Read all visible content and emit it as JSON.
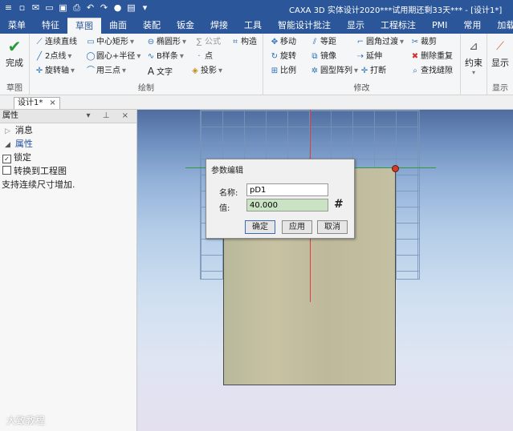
{
  "window": {
    "title": "CAXA 3D 实体设计2020***试用期还剩33天*** - [设计1*]",
    "quick_access_icons": [
      "app-menu-icon",
      "new-file-icon",
      "email-icon",
      "open-folder-icon",
      "save-icon",
      "print-icon",
      "undo-icon",
      "redo-icon",
      "globe-icon",
      "image-icon",
      "dropdown-icon"
    ]
  },
  "menu": {
    "tabs": [
      "菜单",
      "特征",
      "草图",
      "曲面",
      "装配",
      "钣金",
      "焊接",
      "工具",
      "智能设计批注",
      "显示",
      "工程标注",
      "PMI",
      "常用",
      "加载"
    ],
    "active": "草图"
  },
  "ribbon": {
    "groups": {
      "sketch": "草图",
      "draw": "绘制",
      "modify": "修改",
      "display": "显示"
    },
    "finish": "完成",
    "constrain": "约束",
    "display_btn": "显示",
    "draw_items": {
      "polyline": "连续直线",
      "center_rect": "中心矩形",
      "ellipse": "椭圆形",
      "formula": "公式",
      "construct": "构造",
      "two_point_line": "2点线",
      "circle_center_radius": "圆心+半径",
      "bspline": "B样条",
      "point": "点",
      "rotate_axis": "旋转轴",
      "three_point_arc": "用三点",
      "text": "文字",
      "projection": "投影"
    },
    "modify_items": {
      "move": "移动",
      "offset": "等距",
      "fillet": "圆角过渡",
      "trim": "裁剪",
      "rotate": "旋转",
      "mirror": "镜像",
      "extend": "延伸",
      "delete_dup": "删除重复",
      "scale": "比例",
      "circular_array": "圆型阵列",
      "break": "打断",
      "find_gaps": "查找缝隙"
    }
  },
  "document_tab": {
    "label": "设计1*",
    "close": "×"
  },
  "panel": {
    "title": "属性",
    "controls": "▾ ⊥ ×",
    "section_messages": "消息",
    "section_properties": "属性",
    "lock_label": "锁定",
    "lock_checked": true,
    "convert_label": "转换到工程图",
    "convert_checked": false,
    "hint": "支持连续尺寸增加."
  },
  "dialog": {
    "title": "参数编辑",
    "name_label": "名称:",
    "name_value": "pD1",
    "value_label": "值:",
    "value_value": "40.000",
    "hash": "#",
    "ok": "确定",
    "apply": "应用",
    "cancel": "取消"
  },
  "watermark": "大致教程"
}
